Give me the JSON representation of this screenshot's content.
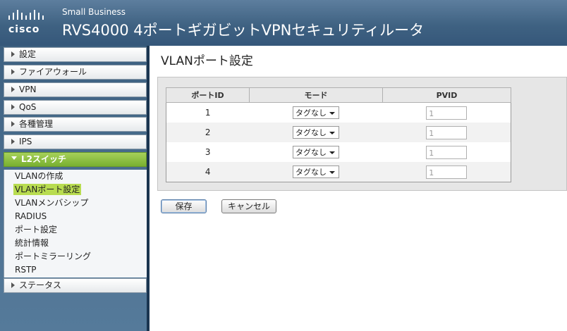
{
  "header": {
    "brand": "cisco",
    "small_business": "Small Business",
    "product_title": "RVS4000 4ポートギガビットVPNセキュリティルータ"
  },
  "sidebar": {
    "items": [
      {
        "label": "設定"
      },
      {
        "label": "ファイアウォール"
      },
      {
        "label": "VPN"
      },
      {
        "label": "QoS"
      },
      {
        "label": "各種管理"
      },
      {
        "label": "IPS"
      },
      {
        "label": "L2スイッチ"
      },
      {
        "label": "ステータス"
      }
    ],
    "subitems": [
      {
        "label": "VLANの作成"
      },
      {
        "label": "VLANポート設定"
      },
      {
        "label": "VLANメンバシップ"
      },
      {
        "label": "RADIUS"
      },
      {
        "label": "ポート設定"
      },
      {
        "label": "統計情報"
      },
      {
        "label": "ポートミラーリング"
      },
      {
        "label": "RSTP"
      }
    ]
  },
  "main": {
    "page_title": "VLANポート設定",
    "table": {
      "headers": [
        "ポートID",
        "モード",
        "PVID"
      ],
      "rows": [
        {
          "port": "1",
          "mode": "タグなし",
          "pvid": "1"
        },
        {
          "port": "2",
          "mode": "タグなし",
          "pvid": "1"
        },
        {
          "port": "3",
          "mode": "タグなし",
          "pvid": "1"
        },
        {
          "port": "4",
          "mode": "タグなし",
          "pvid": "1"
        }
      ]
    },
    "buttons": {
      "save": "保存",
      "cancel": "キャンセル"
    }
  },
  "colors": {
    "header_bg": "#3f6282",
    "sidebar_bg": "#4f7393",
    "active_nav": "#8cc040",
    "selected_subitem": "#b8dc50"
  }
}
